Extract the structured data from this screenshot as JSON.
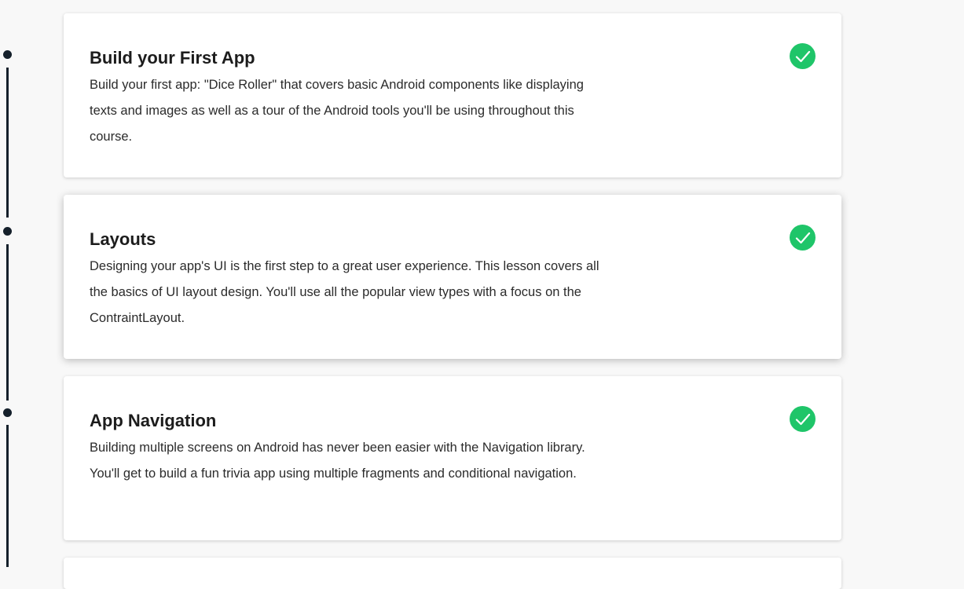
{
  "lessons": [
    {
      "title": "Build your First App",
      "description": "Build your first app: \"Dice Roller\" that covers basic Android components like displaying texts and images as well as a tour of the Android tools you'll be using throughout this course.",
      "completed": true
    },
    {
      "title": "Layouts",
      "description": "Designing your app's UI is the first step to a great user experience. This lesson covers all the basics of UI layout design. You'll use all the popular view types with a focus on the ContraintLayout.",
      "completed": true
    },
    {
      "title": "App Navigation",
      "description": "Building multiple screens on Android has never been easier with the Navigation library. You'll get to build a fun trivia app using multiple fragments and conditional navigation.",
      "completed": true
    }
  ],
  "icons": {
    "completed": "checkmark-icon",
    "timeline_marker": "dot"
  },
  "colors": {
    "completed_check": "#1fc569",
    "timeline": "#15202b",
    "background": "#f8f8f8"
  }
}
